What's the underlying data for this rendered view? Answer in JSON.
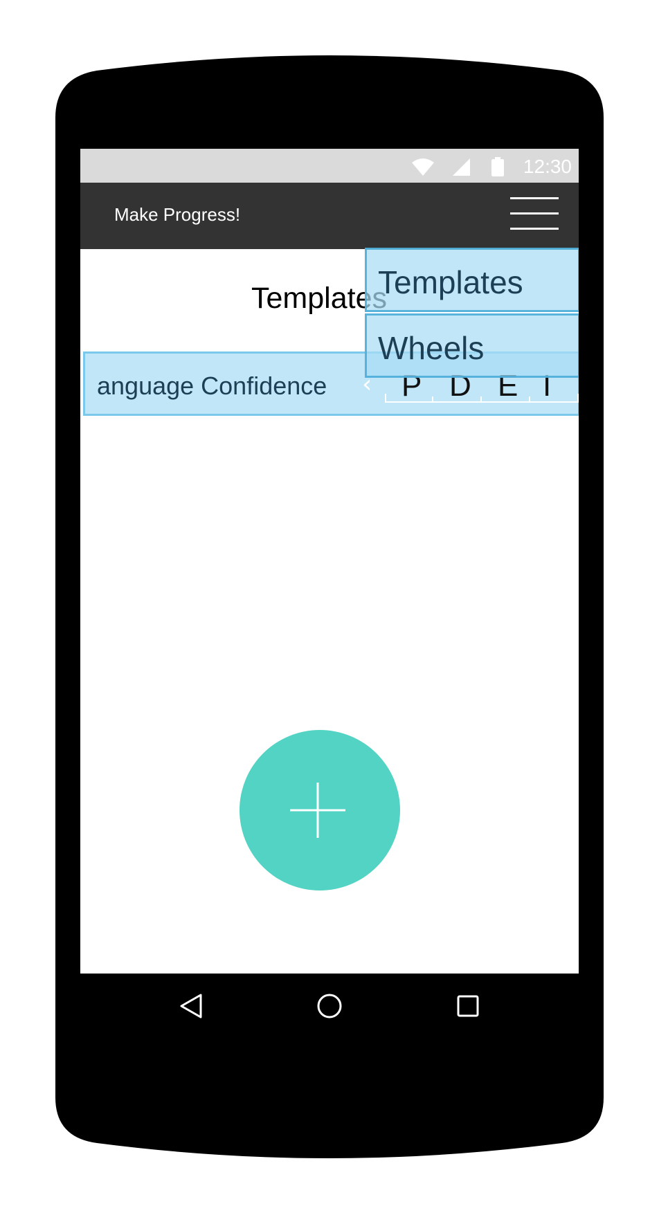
{
  "status_bar": {
    "time": "12:30",
    "icons": [
      "wifi-icon",
      "signal-icon",
      "battery-icon"
    ]
  },
  "app_bar": {
    "title": "Make Progress!",
    "menu_icon": "hamburger-menu-icon"
  },
  "page": {
    "title": "Templates"
  },
  "template_row": {
    "label": "anguage Confidence",
    "chevron": "‹",
    "day_letters": [
      "P",
      "D",
      "E",
      "I"
    ]
  },
  "dropdown_menu": {
    "items": [
      {
        "label": "Templates"
      },
      {
        "label": "Wheels"
      }
    ]
  },
  "fab": {
    "icon": "plus-icon"
  },
  "nav_bar": {
    "buttons": [
      "back-icon",
      "home-icon",
      "recents-icon"
    ]
  },
  "colors": {
    "app_bar": "#333333",
    "status_bar": "#dadada",
    "fab": "#52d3c4",
    "highlight": "#a8ddf5"
  }
}
